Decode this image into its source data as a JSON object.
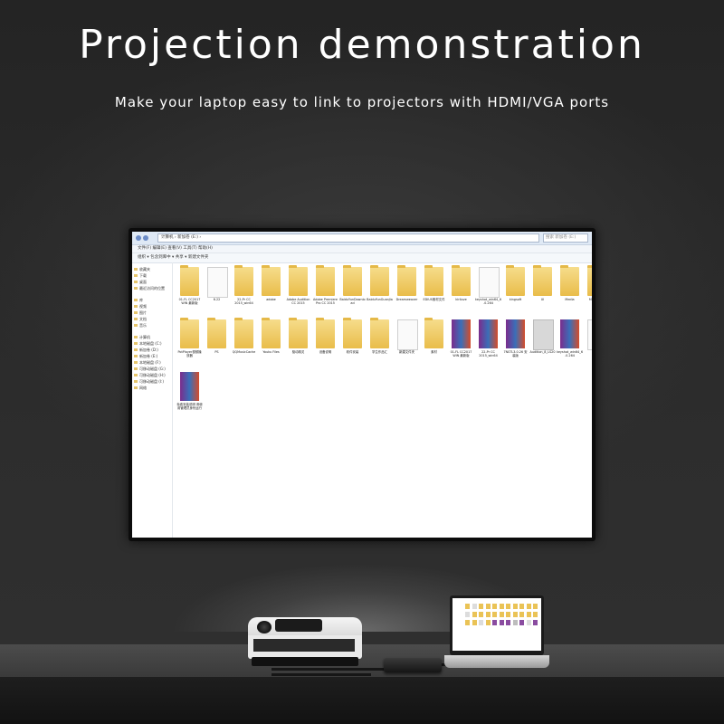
{
  "header": {
    "title": "Projection demonstration",
    "subtitle": "Make your laptop easy to link to projectors with HDMI/VGA ports"
  },
  "explorer": {
    "address": "计算机 › 新加卷 (E:) ›",
    "search_placeholder": "搜索 新加卷 (E:)",
    "menu": "文件(F)  编辑(E)  查看(V)  工具(T)  帮助(H)",
    "toolbar": "组织 ▾   包含到库中 ▾   共享 ▾   新建文件夹",
    "sidebar": [
      {
        "label": "收藏夹"
      },
      {
        "label": "下载"
      },
      {
        "label": "桌面"
      },
      {
        "label": "最近访问的位置"
      },
      {
        "label": ""
      },
      {
        "label": "库"
      },
      {
        "label": "视频"
      },
      {
        "label": "图片"
      },
      {
        "label": "文档"
      },
      {
        "label": "音乐"
      },
      {
        "label": ""
      },
      {
        "label": "计算机"
      },
      {
        "label": "本地磁盘 (C:)"
      },
      {
        "label": "新加卷 (D:)"
      },
      {
        "label": "新加卷 (E:)"
      },
      {
        "label": "本地磁盘 (F:)"
      },
      {
        "label": "可移动磁盘 (G:)"
      },
      {
        "label": "可移动磁盘 (H:)"
      },
      {
        "label": "可移动磁盘 (I:)"
      },
      {
        "label": "网络"
      }
    ],
    "files": [
      {
        "label": "01-FL CC2017 WIN 最新版",
        "icon": "folder"
      },
      {
        "label": "6.22",
        "icon": "doc"
      },
      {
        "label": "22-Pr CC 2015_win64",
        "icon": "folder"
      },
      {
        "label": "adobe",
        "icon": "folder"
      },
      {
        "label": "Adobe Audition CC 2015",
        "icon": "folder"
      },
      {
        "label": "Adobe Premiere Pro CC 2015",
        "icon": "folder"
      },
      {
        "label": "BaiduYunDownload",
        "icon": "folder"
      },
      {
        "label": "BaiduYunGuanJia",
        "icon": "folder"
      },
      {
        "label": "Dreamweaver",
        "icon": "folder"
      },
      {
        "label": "EDIUS素材文件",
        "icon": "folder"
      },
      {
        "label": "kirilove",
        "icon": "folder"
      },
      {
        "label": "keyshot_win64_6.0.264",
        "icon": "doc"
      },
      {
        "label": "kingsoft",
        "icon": "folder"
      },
      {
        "label": "UI",
        "icon": "folder"
      },
      {
        "label": "Media",
        "icon": "folder"
      },
      {
        "label": "MyDrivers",
        "icon": "folder"
      },
      {
        "label": "PotPlayer视频播放器",
        "icon": "folder"
      },
      {
        "label": "PS",
        "icon": "folder"
      },
      {
        "label": "QQMusicCache",
        "icon": "folder"
      },
      {
        "label": "Youku Files",
        "icon": "folder"
      },
      {
        "label": "驱动精灵",
        "icon": "folder"
      },
      {
        "label": "设备说明",
        "icon": "folder"
      },
      {
        "label": "软件安装",
        "icon": "folder"
      },
      {
        "label": "学生作品汇",
        "icon": "folder"
      },
      {
        "label": "新建文件夹",
        "icon": "doc"
      },
      {
        "label": "素材",
        "icon": "folder"
      },
      {
        "label": "01-FL CC2017 WIN 最新版",
        "icon": "rar"
      },
      {
        "label": "22-Pr CC 2015_win64",
        "icon": "rar"
      },
      {
        "label": "7NSTL3.0.26 安装版",
        "icon": "rar"
      },
      {
        "label": "Audition_8_LS20",
        "icon": "adobe"
      },
      {
        "label": "keyshot_win64_6.0.264",
        "icon": "rar"
      },
      {
        "label": "资料",
        "icon": "doc"
      },
      {
        "label": "免费安装说明 请使用管理员身份运行",
        "icon": "rar"
      }
    ]
  },
  "colors": {
    "background": "#2b2b2b",
    "folder": "#eac356",
    "text": "#ffffff"
  }
}
